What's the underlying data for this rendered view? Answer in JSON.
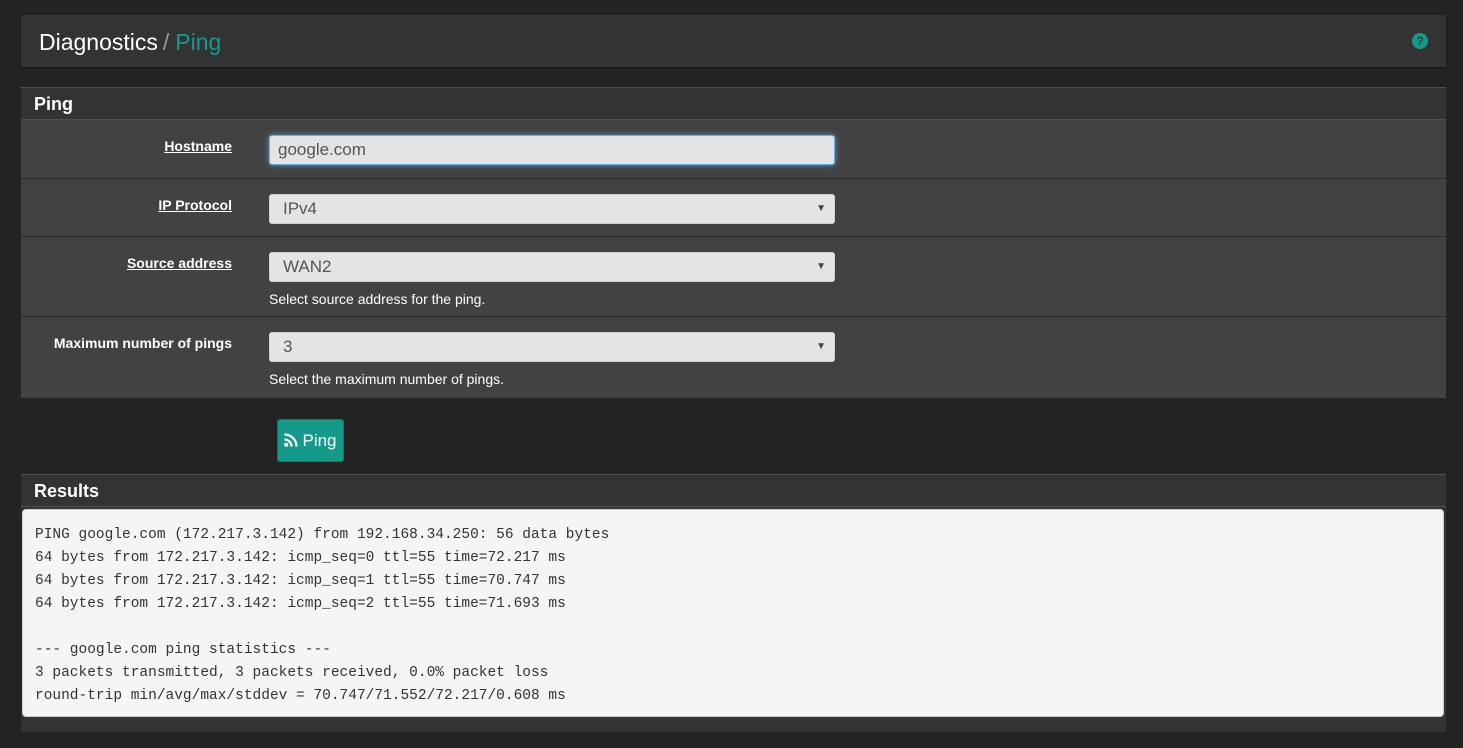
{
  "breadcrumb": {
    "section": "Diagnostics",
    "separator": "/",
    "page": "Ping"
  },
  "help_icon": "question-circle-icon",
  "ping_panel": {
    "title": "Ping",
    "hostname": {
      "label": "Hostname",
      "value": "google.com"
    },
    "ip_protocol": {
      "label": "IP Protocol",
      "selected": "IPv4"
    },
    "source_address": {
      "label": "Source address",
      "selected": "WAN2",
      "help": "Select source address for the ping."
    },
    "max_pings": {
      "label": "Maximum number of pings",
      "selected": "3",
      "help": "Select the maximum number of pings."
    },
    "button_label": "Ping",
    "button_icon": "rss-icon"
  },
  "results": {
    "title": "Results",
    "lines": [
      "PING google.com (172.217.3.142) from 192.168.34.250: 56 data bytes",
      "64 bytes from 172.217.3.142: icmp_seq=0 ttl=55 time=72.217 ms",
      "64 bytes from 172.217.3.142: icmp_seq=1 ttl=55 time=70.747 ms",
      "64 bytes from 172.217.3.142: icmp_seq=2 ttl=55 time=71.693 ms",
      "",
      "--- google.com ping statistics ---",
      "3 packets transmitted, 3 packets received, 0.0% packet loss",
      "round-trip min/avg/max/stddev = 70.747/71.552/72.217/0.608 ms"
    ]
  },
  "colors": {
    "accent": "#159a8a",
    "background": "#232323",
    "panel": "#424242"
  }
}
